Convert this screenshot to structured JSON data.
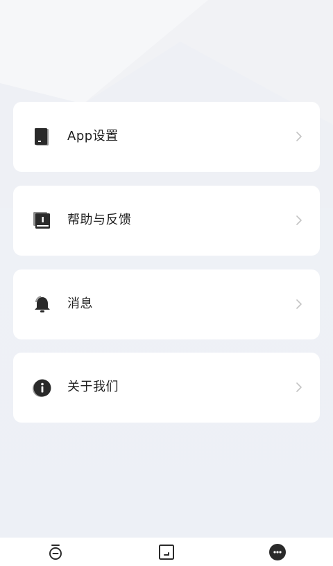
{
  "status_bar": {
    "left_text": "",
    "center_text": "",
    "right_text": ""
  },
  "menu": {
    "items": [
      {
        "label": "App设置",
        "icon": "book-icon"
      },
      {
        "label": "帮助与反馈",
        "icon": "help-book-icon"
      },
      {
        "label": "消息",
        "icon": "bell-icon"
      },
      {
        "label": "关于我们",
        "icon": "info-icon"
      }
    ]
  },
  "tab_bar": {
    "tabs": [
      {
        "icon": "timer-icon",
        "active": false
      },
      {
        "icon": "picture-frame-icon",
        "active": false
      },
      {
        "icon": "more-dots-icon",
        "active": true
      }
    ]
  },
  "colors": {
    "background": "#eef1f6",
    "card": "#ffffff",
    "text": "#1f1f1f",
    "icon": "#2a2a2a",
    "chevron": "#c4c4c4"
  }
}
